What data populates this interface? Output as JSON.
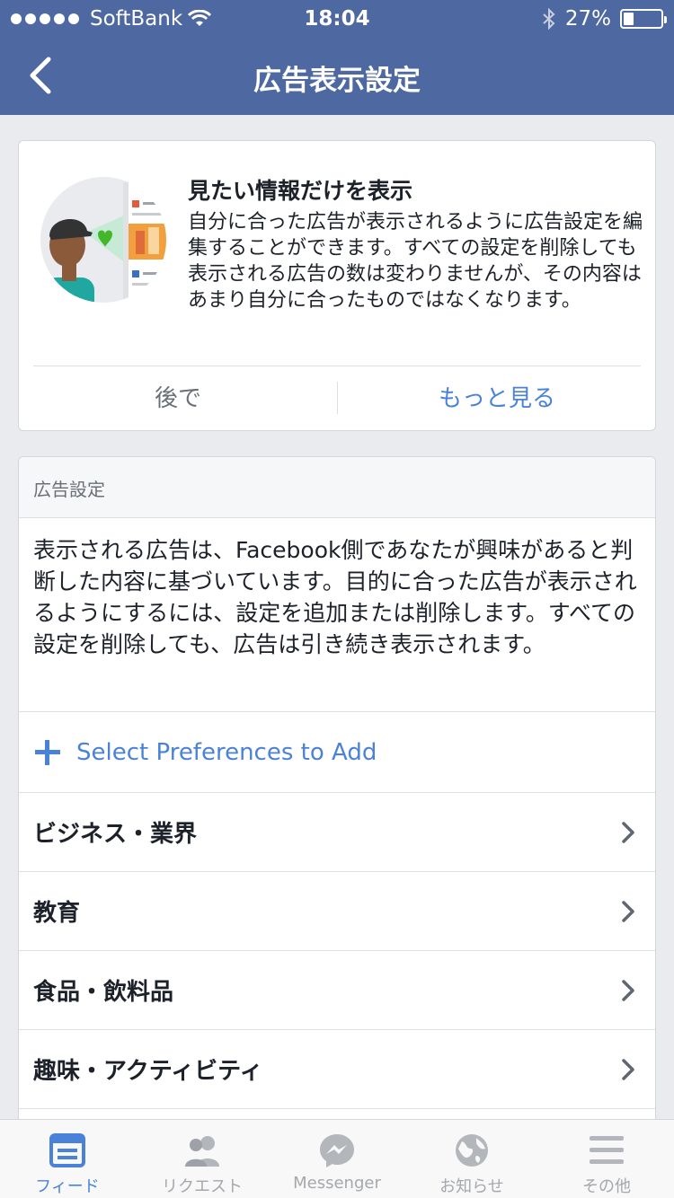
{
  "status_bar": {
    "carrier": "SoftBank",
    "time": "18:04",
    "battery": "27%",
    "battery_level": 0.27
  },
  "nav": {
    "title": "広告表示設定",
    "back_icon": "chevron-left-icon"
  },
  "promo_card": {
    "title": "見たい情報だけを表示",
    "body": "自分に合った広告が表示されるように広告設定を編集することができます。すべての設定を削除しても表示される広告の数は変わりませんが、その内容はあまり自分に合ったものではなくなります。",
    "later_label": "後で",
    "more_label": "もっと見る"
  },
  "ad_settings": {
    "section_header": "広告設定",
    "description": "表示される広告は、Facebook側であなたが興味があると判断した内容に基づいています。目的に合った広告が表示されるようにするには、設定を追加または削除します。すべての設定を削除しても、広告は引き続き表示されます。",
    "add_label": "Select Preferences to Add",
    "categories": [
      {
        "label": "ビジネス・業界"
      },
      {
        "label": "教育"
      },
      {
        "label": "食品・飲料品"
      },
      {
        "label": "趣味・アクティビティ"
      }
    ]
  },
  "tabs": [
    {
      "label": "フィード",
      "icon": "feed-icon",
      "active": true
    },
    {
      "label": "リクエスト",
      "icon": "friend-requests-icon",
      "active": false
    },
    {
      "label": "Messenger",
      "icon": "messenger-icon",
      "active": false
    },
    {
      "label": "お知らせ",
      "icon": "globe-notifications-icon",
      "active": false
    },
    {
      "label": "その他",
      "icon": "menu-icon",
      "active": false
    }
  ],
  "colors": {
    "header_blue": "#4e69a2",
    "link_blue": "#4b82d9",
    "background": "#e9ebee"
  }
}
